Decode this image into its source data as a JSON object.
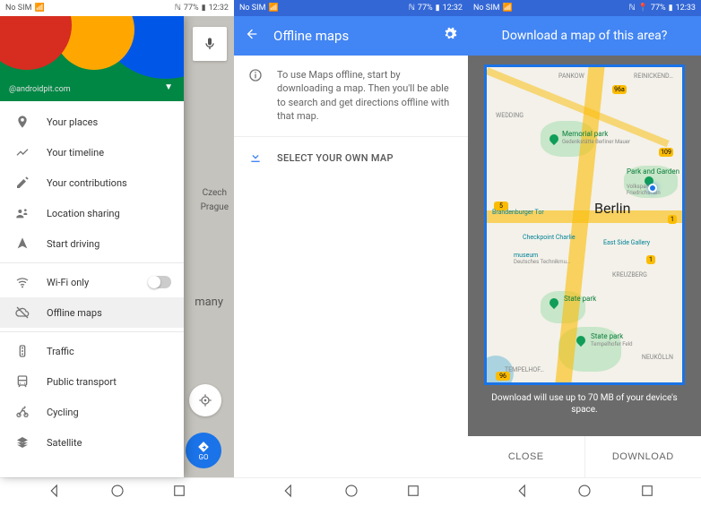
{
  "status": {
    "sim": "No SIM",
    "battery1": "77%",
    "time1": "12:32",
    "battery2": "77%",
    "time2": "12:32",
    "battery3": "77%",
    "time3": "12:33"
  },
  "drawer": {
    "handle": "@androidpit.com",
    "items": [
      {
        "label": "Your places"
      },
      {
        "label": "Your timeline"
      },
      {
        "label": "Your contributions"
      },
      {
        "label": "Location sharing"
      },
      {
        "label": "Start driving"
      },
      {
        "label": "Wi-Fi only"
      },
      {
        "label": "Offline maps"
      },
      {
        "label": "Traffic"
      },
      {
        "label": "Public transport"
      },
      {
        "label": "Cycling"
      },
      {
        "label": "Satellite"
      }
    ],
    "go": "GO",
    "bgmap": {
      "prague": "Prague",
      "czech": "Czech",
      "many": "many"
    }
  },
  "offline": {
    "title": "Offline maps",
    "info": "To use Maps offline, start by downloading a map. Then you'll be able to search and get directions offline with that map.",
    "select": "SELECT YOUR OWN MAP"
  },
  "download": {
    "title": "Download a map of this area?",
    "hint": "Download will use up to 70 MB of your device's space.",
    "close": "CLOSE",
    "download": "DOWNLOAD",
    "map": {
      "berlin": "Berlin",
      "pankow": "PANKOW",
      "reinickend": "REINICKEND…",
      "wedding": "WEDDING",
      "mempark": "Memorial park",
      "mempark2": "Gedenkstätte Berliner Mauer",
      "parkgarden": "Park and Garden",
      "parkgarden2": "Volkspark Friedrichshain",
      "brand": "Brandenburger Tor",
      "checkpoint": "Checkpoint Charlie",
      "eastside": "East Side Gallery",
      "museum": "museum",
      "museum2": "Deutsches Technikmu…",
      "kreuz": "KREUZBERG",
      "state1": "State park",
      "state2": "State park",
      "state2b": "Tempelhofer Feld",
      "tempel": "TEMPELHOF…",
      "neukol": "NEUKÖLLN",
      "hwy96a": "96a",
      "hwy109": "109",
      "hwy96": "96",
      "hwy1a": "1",
      "hwy1b": "1",
      "hwy5": "5"
    }
  }
}
